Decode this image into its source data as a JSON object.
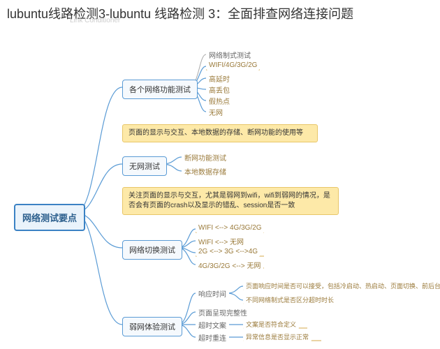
{
  "title": "lubuntu线路检测3-lubuntu 线路检测 3：全面排查网络连接问题",
  "watermark": "Link Conditioner",
  "root": "网络测试要点",
  "branch1": {
    "label": "各个网络功能测试",
    "top_note": "网络制式测试",
    "leaves": [
      "WIFI/4G/3G/2G",
      "高延时",
      "高丢包",
      "假热点",
      "无网"
    ]
  },
  "note1": "页面的显示与交互、本地数据的存储、断网功能的使用等",
  "branch2": {
    "label": "无网测试",
    "leaves": [
      "断网功能测试",
      "本地数据存储"
    ]
  },
  "note2": "关注页面的显示与交互，尤其是弱网到wifi，wifi到弱网的情况，是否会有页面的crash以及显示的错乱、session是否一致",
  "branch3": {
    "label": "网络切换测试",
    "leaves": [
      "WIFI <--> 4G/3G/2G",
      "WIFI <--> 无网",
      "2G <--> 3G <-->4G",
      "4G/3G/2G <--> 无网"
    ]
  },
  "branch4": {
    "label": "弱网体验测试",
    "sub": [
      {
        "label": "响应时间",
        "leaves": [
          "页面响应时间是否可以接受，包括冷启动、热启动、页面切换、前后台切换、首屏时间",
          "不同网络制式是否区分超时时长"
        ]
      },
      {
        "label": "页面呈现完整性",
        "leaves": []
      },
      {
        "label": "超时文案",
        "leaves": [
          "文案是否符合定义"
        ]
      },
      {
        "label": "超时重连",
        "leaves": [
          "异常信息是否显示正常"
        ]
      }
    ]
  }
}
